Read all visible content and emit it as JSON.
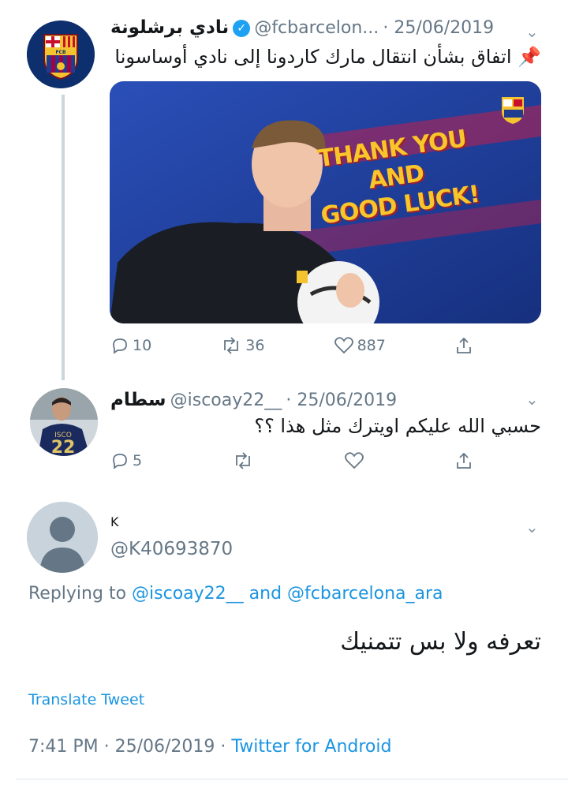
{
  "tweet1": {
    "name": "نادي برشلونة",
    "handle": "@fcbarcelon...",
    "date": "· 25/06/2019",
    "text": "📌 اتفاق بشأن انتقال مارك كاردونا إلى نادي أوساسونا",
    "image_text": [
      "THANK YOU",
      "AND",
      "GOOD LUCK!"
    ],
    "replies": "10",
    "retweets": "36",
    "likes": "887"
  },
  "tweet2": {
    "name": "سطام",
    "handle": "@iscoay22__",
    "date": "· 25/06/2019",
    "text": "حسبي الله عليكم اويترك مثل هذا ؟؟",
    "replies": "5",
    "jersey_number": "22"
  },
  "tweet3": {
    "name": "K",
    "handle": "@K40693870",
    "replying_prefix": "Replying to",
    "replying_user1": "@iscoay22__",
    "replying_and": "and",
    "replying_user2": "@fcbarcelona_ara",
    "text": "تعرفه ولا بس تتمنيك",
    "translate": "Translate Tweet",
    "time": "7:41 PM · 25/06/2019 ·",
    "source": "Twitter for Android"
  },
  "colors": {
    "accent": "#1da1f2",
    "link": "#1b95e0",
    "muted": "#657786"
  }
}
